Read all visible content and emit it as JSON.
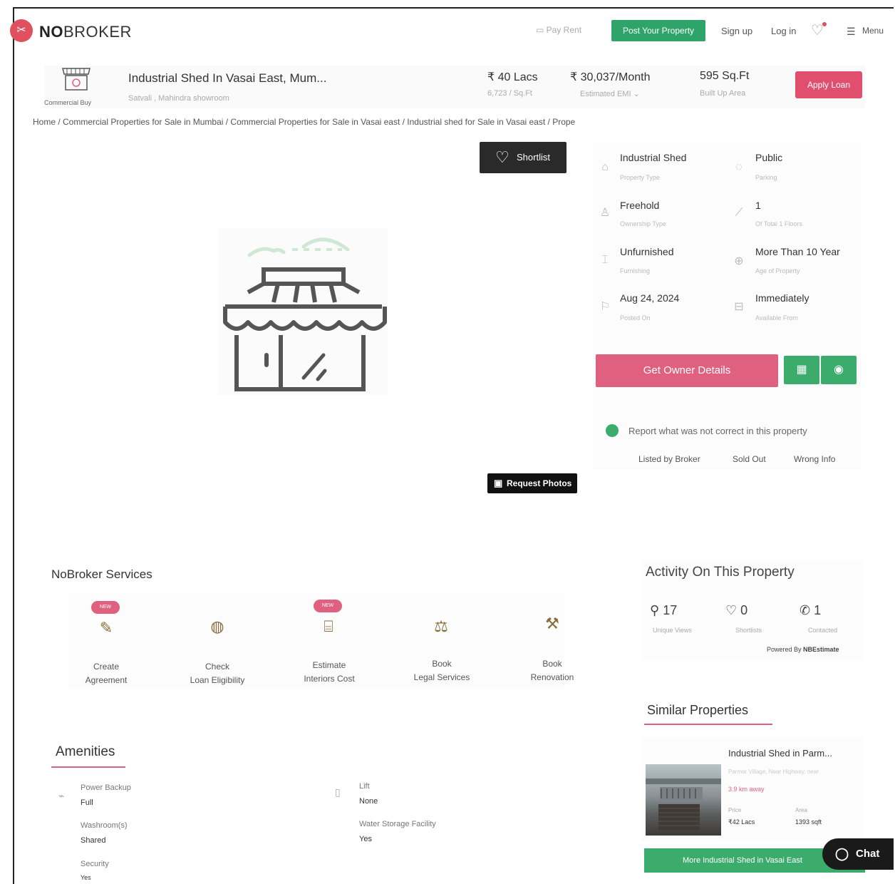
{
  "header": {
    "logo_text_bold": "NO",
    "logo_text_rest": "BROKER",
    "nav": {
      "pay_rent": "Pay Rent",
      "post_property": "Post Your Property",
      "sign_up": "Sign up",
      "log_in": "Log in",
      "menu": "Menu"
    }
  },
  "summary": {
    "category_label": "Commercial Buy",
    "title": "Industrial Shed In Vasai East, Mum...",
    "subtitle": "Satvali , Mahindra showroom",
    "price": "₹ 40 Lacs",
    "price_per_sqft": "6,723 / Sq.Ft",
    "emi": "₹ 30,037/Month",
    "emi_label": "Estimated EMI",
    "area": "595 Sq.Ft",
    "area_label": "Built Up Area",
    "apply_loan": "Apply Loan"
  },
  "breadcrumb": "Home / Commercial Properties for Sale in Mumbai / Commercial Properties for Sale in Vasai east / Industrial shed for Sale in Vasai east / Prope",
  "media": {
    "shortlist": "Shortlist",
    "request_photos": "Request Photos"
  },
  "details": [
    {
      "value": "Industrial Shed",
      "label": "Property Type"
    },
    {
      "value": "Public",
      "label": "Parking"
    },
    {
      "value": "Freehold",
      "label": "Ownership Type"
    },
    {
      "value": "1",
      "label": "Of Total 1 Floors"
    },
    {
      "value": "Unfurnished",
      "label": "Furnishing"
    },
    {
      "value": "More Than 10 Year",
      "label": "Age of Property"
    },
    {
      "value": "Aug 24, 2024",
      "label": "Posted On"
    },
    {
      "value": "Immediately",
      "label": "Available From"
    }
  ],
  "actions": {
    "owner_details": "Get Owner Details"
  },
  "report": {
    "text": "Report what was not correct in this property",
    "options": [
      "Listed by Broker",
      "Sold Out",
      "Wrong Info"
    ]
  },
  "services": {
    "title": "NoBroker Services",
    "badge": "NEW",
    "items": [
      {
        "line1": "Create",
        "line2": "Agreement"
      },
      {
        "line1": "Check",
        "line2": "Loan Eligibility"
      },
      {
        "line1": "Estimate",
        "line2": "Interiors Cost"
      },
      {
        "line1": "Book",
        "line2": "Legal Services"
      },
      {
        "line1": "Book",
        "line2": "Renovation"
      }
    ]
  },
  "amenities": {
    "title": "Amenities",
    "items": [
      {
        "label": "Power Backup",
        "value": "Full"
      },
      {
        "label": "Washroom(s)",
        "value": "Shared"
      },
      {
        "label": "Security",
        "value": "Yes"
      },
      {
        "label": "Lift",
        "value": "None"
      },
      {
        "label": "Water Storage Facility",
        "value": "Yes"
      }
    ]
  },
  "activity": {
    "title": "Activity On This Property",
    "stats": [
      {
        "value": "17",
        "label": "Unique Views"
      },
      {
        "value": "0",
        "label": "Shortlists"
      },
      {
        "value": "1",
        "label": "Contacted"
      }
    ],
    "powered_by": "Powered By",
    "powered_brand": "NBEstimate"
  },
  "similar": {
    "title": "Similar Properties",
    "card": {
      "title": "Industrial Shed in Parm...",
      "subtitle": "Parmar Village, Near Highway, near",
      "distance": "3.9 km away",
      "price_label": "Price",
      "price": "₹42 Lacs",
      "area_label": "Area",
      "area": "1393 sqft"
    },
    "more_button": "More Industrial Shed in Vasai East"
  },
  "chat": "Chat",
  "colors": {
    "brand": "#e0505f",
    "accent_pink": "#e0607f",
    "accent_green": "#3cac6c"
  }
}
